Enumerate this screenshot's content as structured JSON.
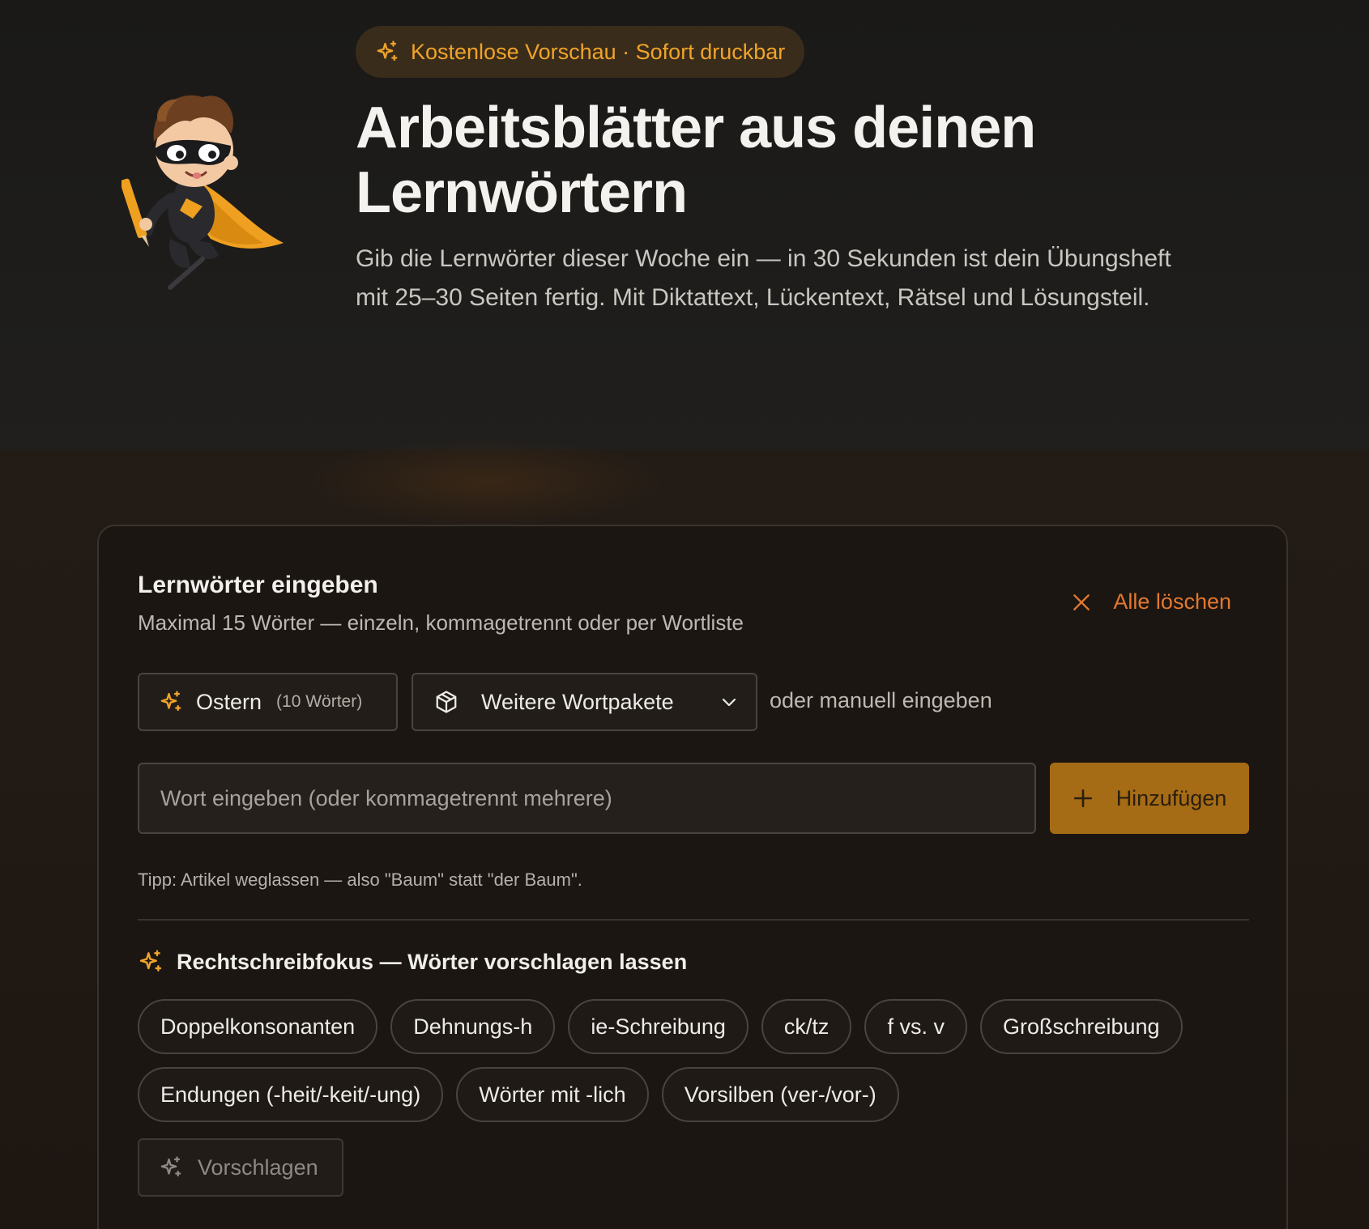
{
  "badge": {
    "text": "Kostenlose Vorschau · Sofort druckbar",
    "icon": "sparkles-icon"
  },
  "hero": {
    "title_line1": "Arbeitsblätter aus deinen",
    "title_line2": "Lernwörtern",
    "subtitle": "Gib die Lernwörter dieser Woche ein — in 30 Sekunden ist dein Übungsheft mit 25–30 Seiten fertig. Mit Diktattext, Lückentext, Rätsel und Lösungsteil."
  },
  "card": {
    "title": "Lernwörter eingeben",
    "description": "Maximal 15 Wörter — einzeln, kommagetrennt oder per Wortliste",
    "clear_all": "Alle löschen",
    "easter_button": {
      "label": "Ostern",
      "count": "(10 Wörter)"
    },
    "packs_button": {
      "label": "Weitere Wortpakete"
    },
    "manual_text": "oder manuell eingeben",
    "input": {
      "placeholder": "Wort eingeben (oder kommagetrennt mehrere)",
      "value": ""
    },
    "add_button": "Hinzufügen",
    "tip": "Tipp: Artikel weglassen — also \"Baum\" statt \"der Baum\".",
    "focus_heading": "Rechtschreibfokus — Wörter vorschlagen lassen",
    "chips_row1": [
      "Doppelkonsonanten",
      "Dehnungs-h",
      "ie-Schreibung",
      "ck/tz",
      "f vs. v",
      "Großschreibung"
    ],
    "chips_row2": [
      "Endungen (-heit/-keit/-ung)",
      "Wörter mit -lich",
      "Vorsilben (ver-/vor-)"
    ],
    "suggest_button": "Vorschlagen"
  },
  "colors": {
    "accent": "#f0a42a",
    "accent_button": "#a66b15",
    "danger": "#e2782e",
    "background": "#1c1b19"
  }
}
